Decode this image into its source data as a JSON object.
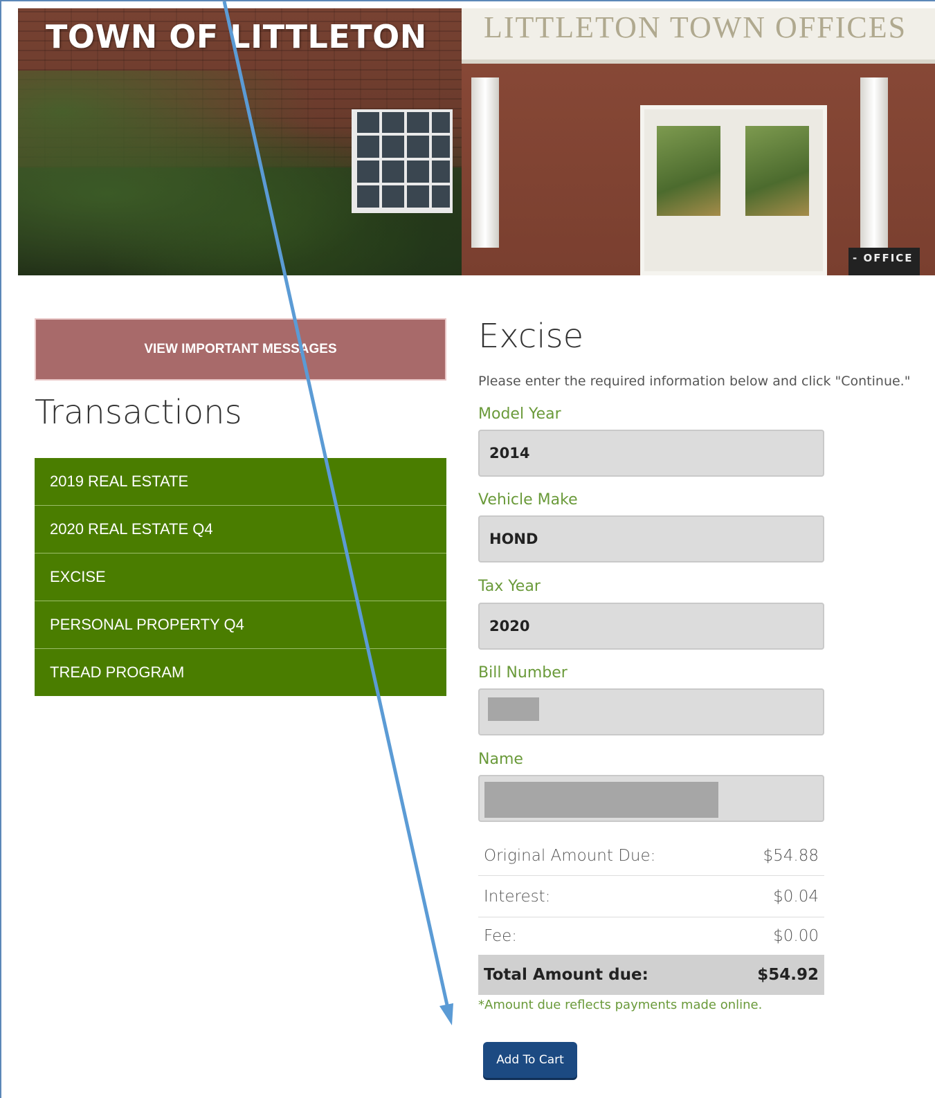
{
  "hero": {
    "title": "TOWN OF LITTLETON",
    "sign_text": "LITTLETON TOWN OFFICES",
    "plaque_text": "- OFFICE"
  },
  "sidebar": {
    "messages_button": "VIEW IMPORTANT MESSAGES",
    "transactions_title": "Transactions",
    "items": [
      {
        "label": "2019 REAL ESTATE"
      },
      {
        "label": "2020 REAL ESTATE Q4"
      },
      {
        "label": "EXCISE"
      },
      {
        "label": "PERSONAL PROPERTY Q4"
      },
      {
        "label": "TREAD PROGRAM"
      }
    ]
  },
  "form": {
    "title": "Excise",
    "instructions": "Please enter the required information below and click \"Continue.\"",
    "fields": {
      "model_year": {
        "label": "Model Year",
        "value": "2014"
      },
      "vehicle_make": {
        "label": "Vehicle Make",
        "value": "HOND"
      },
      "tax_year": {
        "label": "Tax Year",
        "value": "2020"
      },
      "bill_number": {
        "label": "Bill Number",
        "value": ""
      },
      "name": {
        "label": "Name",
        "value": ""
      }
    }
  },
  "summary": {
    "original": {
      "label": "Original Amount Due:",
      "value": "$54.88"
    },
    "interest": {
      "label": "Interest:",
      "value": "$0.04"
    },
    "fee": {
      "label": "Fee:",
      "value": "$0.00"
    },
    "total": {
      "label": "Total Amount due:",
      "value": "$54.92"
    },
    "note": "*Amount due reflects payments made online."
  },
  "actions": {
    "add_to_cart": "Add To Cart"
  },
  "colors": {
    "accent_green": "#4a7d00",
    "label_green": "#6a9a3a",
    "messages_button": "#a86a6a",
    "cart_button": "#1c4a82",
    "annotation_arrow": "#5b9bd5"
  }
}
